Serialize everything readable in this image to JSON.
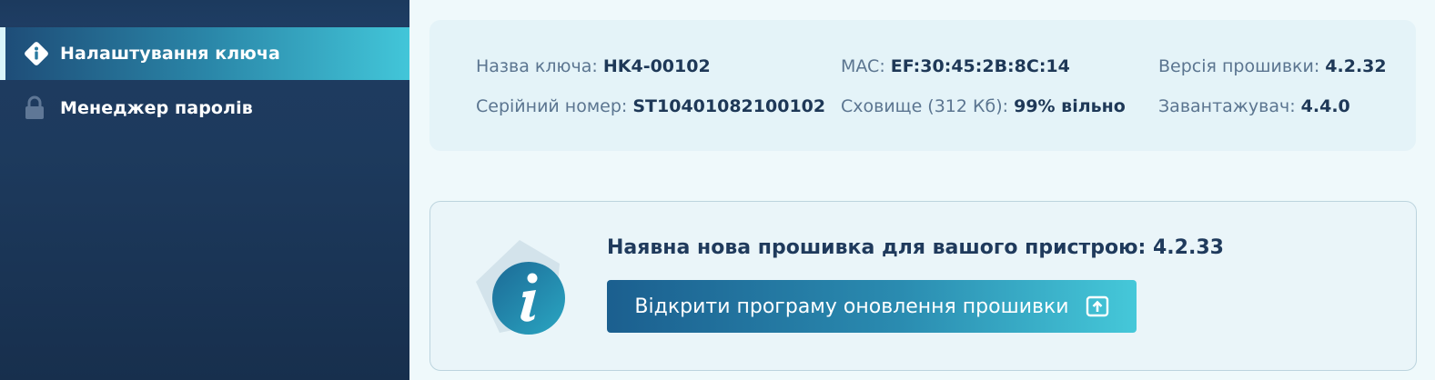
{
  "sidebar": {
    "items": [
      {
        "label": "Налаштування ключа",
        "icon": "diamond-info-icon",
        "active": true
      },
      {
        "label": "Менеджер паролів",
        "icon": "lock-icon",
        "active": false
      }
    ]
  },
  "device_info": {
    "name_label": "Назва ключа: ",
    "name_value": "HK4-00102",
    "serial_label": "Серійний номер: ",
    "serial_value": "ST10401082100102",
    "mac_label": "MAC: ",
    "mac_value": "EF:30:45:2B:8C:14",
    "storage_label": "Сховище (312 Кб): ",
    "storage_value": "99% вільно",
    "firmware_label": "Версія прошивки: ",
    "firmware_value": "4.2.32",
    "bootloader_label": "Завантажувач: ",
    "bootloader_value": "4.4.0"
  },
  "update": {
    "title": "Наявна нова прошивка для вашого пристрою: 4.2.33",
    "button_label": "Відкрити програму оновлення прошивки",
    "button_icon": "open-external-icon"
  },
  "colors": {
    "sidebar_bg": "#1d3a5d",
    "accent_start": "#1b5f8f",
    "accent_end": "#45c8d9",
    "text_dark": "#1e3857",
    "text_muted": "#5b7590"
  }
}
